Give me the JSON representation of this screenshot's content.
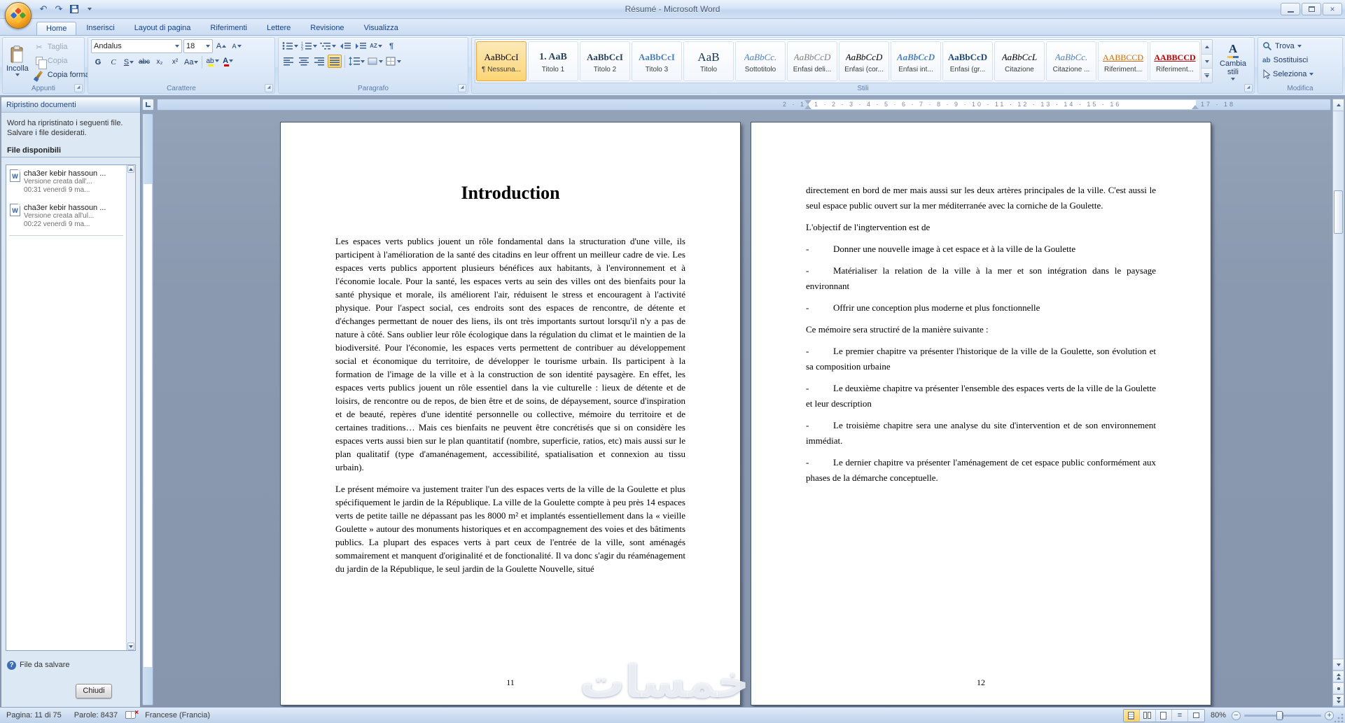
{
  "window": {
    "title": "Résumé - Microsoft Word"
  },
  "icons": {
    "undo": "↶",
    "redo": "↷",
    "close": "×",
    "cut": "✂",
    "pilcrow": "¶",
    "help": "?",
    "spell_error": "×"
  },
  "ribbon": {
    "tabs": [
      {
        "label": "Home"
      },
      {
        "label": "Inserisci"
      },
      {
        "label": "Layout di pagina"
      },
      {
        "label": "Riferimenti"
      },
      {
        "label": "Lettere"
      },
      {
        "label": "Revisione"
      },
      {
        "label": "Visualizza"
      }
    ],
    "clipboard": {
      "label": "Appunti",
      "paste": "Incolla",
      "cut": "Taglia",
      "copy": "Copia",
      "format_painter": "Copia formato"
    },
    "font": {
      "label": "Carattere",
      "name": "Andalus",
      "size": "18",
      "grow": "A",
      "shrink": "A",
      "bold": "G",
      "italic": "C",
      "underline": "S",
      "strike": "abc",
      "sub": "x₂",
      "sup": "x²",
      "case_label": "Aa",
      "highlight": "ab",
      "color_label": "A"
    },
    "paragraph": {
      "label": "Paragrafo",
      "sort": "AZ"
    },
    "styles": {
      "label": "Stili",
      "change": "Cambia stili",
      "items": [
        {
          "sample": "AaBbCcI",
          "label": "¶ Nessuna..."
        },
        {
          "sample": "1. AaB",
          "label": "Titolo 1"
        },
        {
          "sample": "AaBbCcI",
          "label": "Titolo 2"
        },
        {
          "sample": "AaBbCcI",
          "label": "Titolo 3"
        },
        {
          "sample": "AaB",
          "label": "Titolo"
        },
        {
          "sample": "AaBbCc.",
          "label": "Sottotitolo"
        },
        {
          "sample": "AaBbCcD",
          "label": "Enfasi deli..."
        },
        {
          "sample": "AaBbCcD",
          "label": "Enfasi (cor..."
        },
        {
          "sample": "AaBbCcD",
          "label": "Enfasi int..."
        },
        {
          "sample": "AaBbCcD",
          "label": "Enfasi (gr..."
        },
        {
          "sample": "AaBbCcL",
          "label": "Citazione"
        },
        {
          "sample": "AaBbCc.",
          "label": "Citazione ..."
        },
        {
          "sample": "AABBCCD",
          "label": "Riferiment..."
        },
        {
          "sample": "AABBCCD",
          "label": "Riferiment..."
        }
      ]
    },
    "editing": {
      "label": "Modifica",
      "find": "Trova",
      "replace": "Sostituisci",
      "select": "Seleziona"
    }
  },
  "recovery": {
    "title": "Ripristino documenti",
    "message": "Word ha ripristinato i seguenti file. Salvare i file desiderati.",
    "files_header": "File disponibili",
    "files": [
      {
        "name": "cha3er kebir hassoun ...",
        "version": "Versione creata dall'...",
        "time": "00:31 venerdì 9 ma..."
      },
      {
        "name": "cha3er kebir hassoun ...",
        "version": "Versione creata all'ul...",
        "time": "00:22 venerdì 9 ma..."
      }
    ],
    "which_file": "File da salvare",
    "close": "Chiudi"
  },
  "ruler": {
    "left": "2 · 1",
    "main": "1 · 2 · 3 · 4 · 5 · 6 · 7 · 8 · 9 · 10 · 11 · 12 · 13 · 14 · 15 · 16",
    "right": "17 · 18"
  },
  "document": {
    "list_marker": "-",
    "watermark": "خمسات",
    "page1": {
      "number": "11",
      "title": "Introduction",
      "paragraphs": [
        "Les espaces verts publics jouent un rôle fondamental dans la structuration d'une ville, ils participent à l'amélioration de la santé des citadins en leur offrent un meilleur cadre de vie. Les espaces verts publics apportent plusieurs bénéfices aux habitants, à l'environnement et à l'économie locale. Pour la santé, les espaces verts au sein des villes ont des bienfaits pour la santé physique et morale, ils améliorent l'air, réduisent le stress et encouragent à l'activité physique. Pour l'aspect social, ces endroits sont des espaces de rencontre, de détente et d'échanges permettant de nouer des liens, ils ont très importants surtout lorsqu'il n'y a pas de nature à côté. Sans oublier leur rôle écologique dans la régulation du climat et le maintien de la biodiversité. Pour l'économie, les espaces verts permettent de contribuer au développement social et économique du territoire, de développer le tourisme urbain. Ils participent à la formation de l'image de la ville et à la construction de son identité paysagère. En effet, les espaces verts publics jouent un rôle essentiel dans la vie culturelle : lieux de détente et de loisirs, de rencontre ou de repos, de bien être et de soins, de dépaysement, source d'inspiration et de beauté, repères d'une identité personnelle ou collective, mémoire du territoire et de certaines traditions… Mais ces bienfaits ne peuvent être concrétisés que si on considère les espaces verts aussi bien sur le plan quantitatif (nombre, superficie, ratios, etc) mais aussi sur le plan qualitatif (type d'amanénagement, accessibilité, spatialisation et connexion au tissu urbain).",
        "Le présent mémoire va justement traiter l'un des espaces verts de la ville de la Goulette et plus spécifiquement le jardin de la République. La ville de la Goulette compte à peu près 14 espaces verts de petite taille ne dépassant pas les 8000 m² et implantés essentiellement dans la « vieille Goulette » autour des monuments historiques et en accompagnement des voies et des bâtiments publics.  La plupart des espaces verts à part ceux de l'entrée de la ville, sont aménagés sommairement et manquent d'originalité et de fonctionalité. Il va donc s'agir du réaménagement du jardin de la République, le seul jardin de la Goulette Nouvelle, situé"
      ]
    },
    "page2": {
      "number": "12",
      "blocks": [
        "directement en bord de mer mais aussi sur les deux artères principales de la ville. C'est aussi le seul espace public ouvert sur la mer méditerranée avec la corniche de la Goulette.",
        "L'objectif de l'ingtervention est de",
        "Donner une nouvelle image à cet espace et à la ville de la Goulette",
        "Matérialiser la relation de la ville à la mer et son intégration dans le paysage environnant",
        "Offrir une conception plus moderne et plus fonctionnelle",
        "Ce mémoire sera structiré de la manière suivante :",
        "Le premier chapitre va présenter l'historique de la ville de la Goulette, son évolution et sa composition urbaine",
        "Le deuxième chapitre va présenter l'ensemble des espaces verts de la ville de la Goulette et leur description",
        "Le troisième chapitre sera une analyse du site d'intervention et de son environnement immédiat.",
        "Le dernier chapitre va présenter l'aménagement de cet espace public conformément aux phases de la démarche conceptuelle."
      ]
    }
  },
  "status": {
    "page": "Pagina: 11 di 75",
    "words": "Parole: 8437",
    "language": "Francese (Francia)",
    "zoom": "80%"
  }
}
